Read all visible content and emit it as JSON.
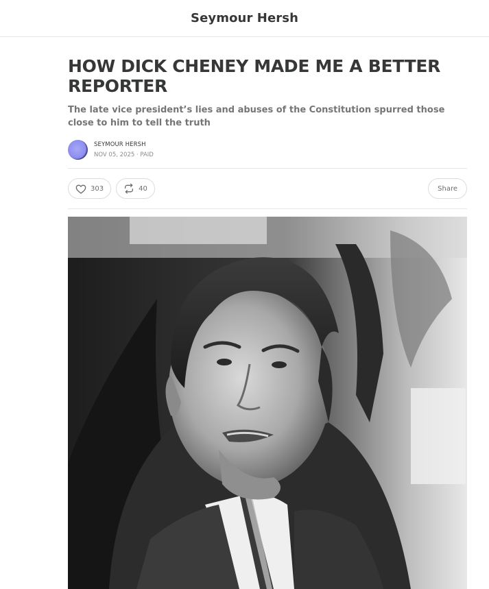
{
  "header": {
    "publication_name": "Seymour Hersh"
  },
  "post": {
    "title": "HOW DICK CHENEY MADE ME A BETTER REPORTER",
    "subtitle": "The late vice president’s lies and abuses of the Constitution spurred those close to him to tell the truth",
    "author": "SEYMOUR HERSH",
    "date": "NOV 05, 2025",
    "meta_separator": " · ",
    "access": "PAID"
  },
  "actions": {
    "like_icon": "heart-icon",
    "like_count": "303",
    "restack_icon": "restack-icon",
    "restack_count": "40",
    "share_label": "Share"
  },
  "hero_image": {
    "description": "black-and-white-portrait",
    "style": "grayscale"
  },
  "colors": {
    "text": "#363737",
    "subtitle": "#757575",
    "meta": "#8a8a8a",
    "border": "#e6e6e6"
  }
}
